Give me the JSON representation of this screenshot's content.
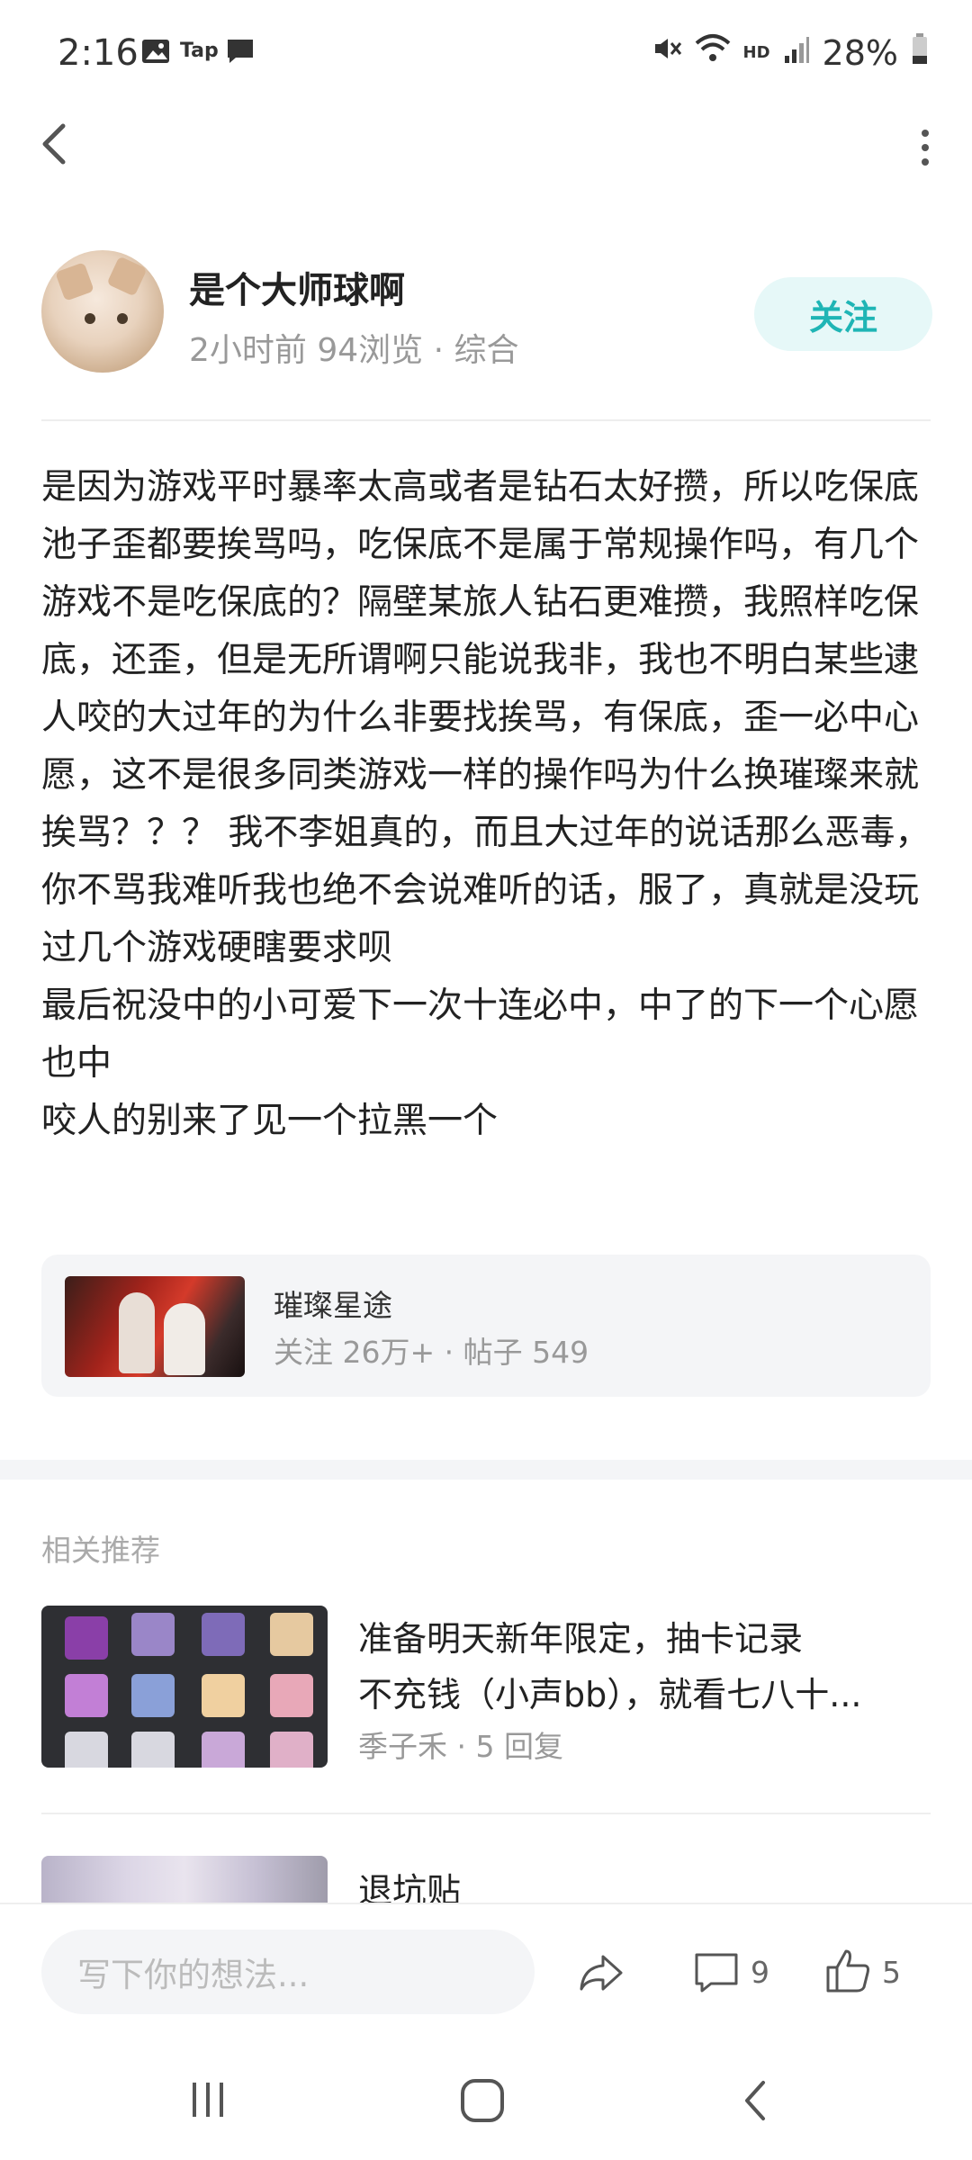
{
  "status_bar": {
    "time": "2:16",
    "left_icons": [
      "image-icon",
      "tap-icon",
      "message-icon"
    ],
    "tap_label": "Tap",
    "hd_label": "HD",
    "battery": "28%"
  },
  "author": {
    "name": "是个大师球啊",
    "meta": "2小时前  94浏览 · 综合",
    "follow_label": "关注"
  },
  "post": {
    "content": "是因为游戏平时暴率太高或者是钻石太好攒，所以吃保底池子歪都要挨骂吗，吃保底不是属于常规操作吗，有几个游戏不是吃保底的？隔壁某旅人钻石更难攒，我照样吃保底，还歪，但是无所谓啊只能说我非，我也不明白某些逮人咬的大过年的为什么非要找挨骂，有保底，歪一必中心愿，这不是很多同类游戏一样的操作吗为什么换璀璨来就挨骂？？？ 我不李姐真的，而且大过年的说话那么恶毒，你不骂我难听我也绝不会说难听的话，服了，真就是没玩过几个游戏硬瞎要求呗\n最后祝没中的小可爱下一次十连必中，中了的下一个心愿也中\n咬人的别来了见一个拉黑一个"
  },
  "topic": {
    "title": "璀璨星途",
    "meta": "关注 26万+ · 帖子 549"
  },
  "recommend": {
    "header": "相关推荐",
    "items": [
      {
        "title_line1": "准备明天新年限定，抽卡记录",
        "title_line2": "不充钱（小声bb），就看七八十...",
        "meta": "季子禾 · 5 回复"
      },
      {
        "title_line1": "退坑贴"
      }
    ]
  },
  "action_bar": {
    "input_placeholder": "写下你的想法...",
    "comment_count": "9",
    "like_count": "5"
  },
  "colors": {
    "accent": "#1fb5b5",
    "follow_bg": "#e6f8f8"
  }
}
